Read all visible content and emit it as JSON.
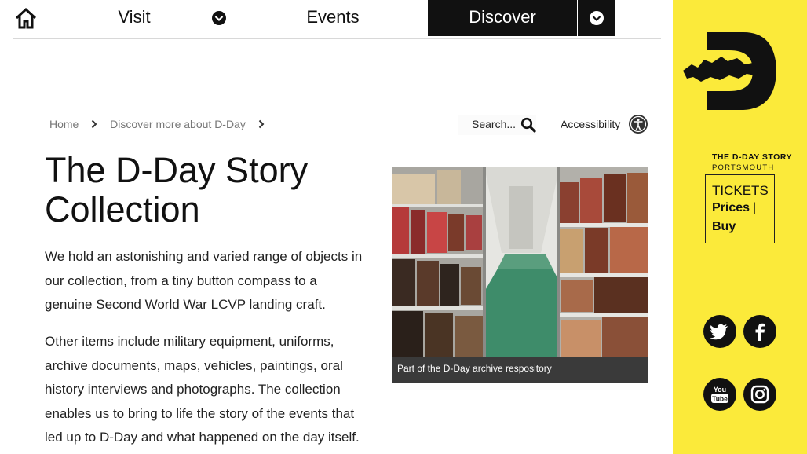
{
  "nav": {
    "home_icon": "home-icon",
    "items": [
      {
        "label": "Visit",
        "has_dropdown": true
      },
      {
        "label": "Events",
        "has_dropdown": false
      },
      {
        "label": "Discover",
        "has_dropdown": true,
        "active": true
      }
    ]
  },
  "breadcrumb": {
    "items": [
      "Home",
      "Discover more about D-Day"
    ]
  },
  "search": {
    "label": "Search..."
  },
  "accessibility": {
    "label": "Accessibility"
  },
  "page": {
    "title": "The D-Day Story Collection",
    "paragraphs": [
      "We hold an astonishing and varied range of objects in our collection, from a tiny button compass to a genuine Second World War LCVP landing craft.",
      "Other items include military equipment, uniforms, archive documents, maps, vehicles, paintings, oral history interviews and photographs. The collection enables us to bring to life the story of the events that led up to D-Day and what happened on the day itself."
    ]
  },
  "figure": {
    "caption": "Part of the D-Day archive respository"
  },
  "sidebar": {
    "logo_line1": "THE D-DAY STORY",
    "logo_line2": "PORTSMOUTH",
    "tickets_title": "TICKETS",
    "tickets_prices": "Prices",
    "tickets_separator": "|",
    "tickets_buy": "Buy",
    "social": [
      "twitter-icon",
      "facebook-icon",
      "youtube-icon",
      "instagram-icon"
    ]
  },
  "colors": {
    "accent_yellow": "#fbea3a",
    "nav_active": "#111111"
  }
}
